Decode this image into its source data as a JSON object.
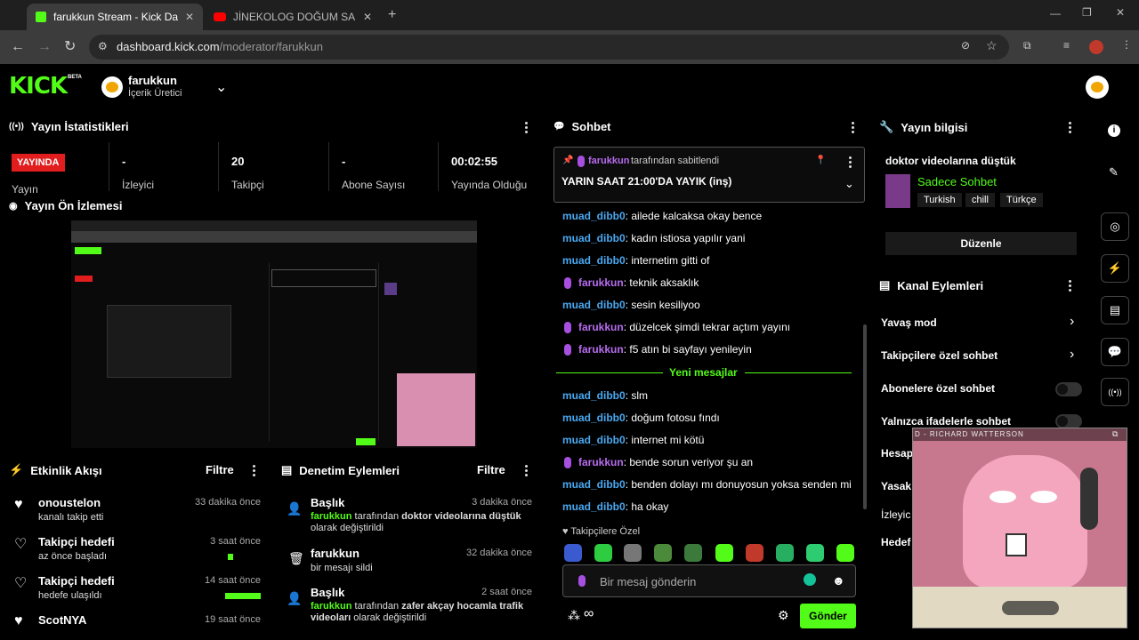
{
  "browser": {
    "tabs": [
      {
        "label": "farukkun Stream - Kick Dashboard"
      },
      {
        "label": "JİNEKOLOG DOĞUM SAHNELERİ"
      }
    ],
    "url_host": "dashboard.kick.com",
    "url_path": "/moderator/farukkun"
  },
  "header": {
    "logo_text": "KICK",
    "logo_badge": "BETA",
    "channel_name": "farukkun",
    "channel_role": "İçerik Üretici"
  },
  "stats": {
    "title": "Yayın İstatistikleri",
    "live_badge": "YAYINDA",
    "live_label": "Yayın",
    "viewers_value": "-",
    "viewers_label": "İzleyici",
    "followers_value": "20",
    "followers_label": "Takipçi",
    "subs_value": "-",
    "subs_label": "Abone Sayısı",
    "duration_value": "00:02:55",
    "duration_label": "Yayında Olduğu"
  },
  "preview": {
    "title": "Yayın Ön İzlemesi"
  },
  "activity": {
    "title": "Etkinlik Akışı",
    "filter": "Filtre",
    "items": [
      {
        "title": "onoustelon",
        "sub": "kanalı takip etti",
        "time": "33 dakika önce"
      },
      {
        "title": "Takipçi hedefi",
        "sub": "az önce başladı",
        "time": "3 saat önce"
      },
      {
        "title": "Takipçi hedefi",
        "sub": "hedefe ulaşıldı",
        "time": "14 saat önce"
      },
      {
        "title": "ScotNYA",
        "sub": "",
        "time": "19 saat önce"
      }
    ]
  },
  "moderation": {
    "title": "Denetim Eylemleri",
    "filter": "Filtre",
    "items": [
      {
        "title": "Başlık",
        "time": "3 dakika önce",
        "user": "farukkun",
        "mid": " tarafından ",
        "bold": "doktor videolarına düştük",
        "end": " olarak değiştirildi"
      },
      {
        "title": "farukkun",
        "time": "32 dakika önce",
        "line": "bir mesajı sildi"
      },
      {
        "title": "Başlık",
        "time": "2 saat önce",
        "user": "farukkun",
        "mid": " tarafından ",
        "bold": "zafer akçay hocamla trafik videoları",
        "end": " olarak değiştirildi"
      }
    ]
  },
  "chat": {
    "title": "Sohbet",
    "pinned_user": "farukkun",
    "pinned_by": "tarafından sabitlendi",
    "pinned_message": "YARIN SAAT 21:00'DA YAYIK (inş)",
    "messages_before": [
      {
        "user": "muad_dibb0",
        "text": ": ailede kalcaksa okay bence",
        "host": false
      },
      {
        "user": "muad_dibb0",
        "text": ": kadın istiosa yapılır yani",
        "host": false
      },
      {
        "user": "muad_dibb0",
        "text": ": internetim gitti of",
        "host": false
      },
      {
        "user": "farukkun",
        "text": ": teknik aksaklık",
        "host": true
      },
      {
        "user": "muad_dibb0",
        "text": ": sesin kesiliyoo",
        "host": false
      },
      {
        "user": "farukkun",
        "text": ": düzelcek şimdi tekrar açtım yayını",
        "host": true
      },
      {
        "user": "farukkun",
        "text": ": f5 atın bi sayfayı yenileyin",
        "host": true
      }
    ],
    "new_messages": "Yeni mesajlar",
    "messages_after": [
      {
        "user": "muad_dibb0",
        "text": ": slm",
        "host": false
      },
      {
        "user": "muad_dibb0",
        "text": ": doğum fotosu fındı",
        "host": false
      },
      {
        "user": "muad_dibb0",
        "text": ": internet mi kötü",
        "host": false
      },
      {
        "user": "farukkun",
        "text": ": bende sorun veriyor şu an",
        "host": true
      },
      {
        "user": "muad_dibb0",
        "text": ": benden dolayı mı donuyosun yoksa senden mi",
        "host": false
      },
      {
        "user": "muad_dibb0",
        "text": ": ha okay",
        "host": false
      }
    ],
    "followers_only": "Takipçilere Özel",
    "input_placeholder": "Bir mesaj gönderin",
    "send": "Gönder"
  },
  "stream_info": {
    "title": "Yayın bilgisi",
    "stream_title": "doktor videolarına düştük",
    "category": "Sadece Sohbet",
    "tags": [
      "Turkish",
      "chill",
      "Türkçe"
    ],
    "edit": "Düzenle"
  },
  "channel_actions": {
    "title": "Kanal Eylemleri",
    "slow_mode": "Yavaş mod",
    "followers_chat": "Takipçilere özel sohbet",
    "subs_chat": "Abonelere özel sohbet",
    "emote_chat": "Yalnızca ifadelerle sohbet",
    "cut1": "Hesap",
    "cut2": "Yasak",
    "cut3": "İzleyic",
    "cut4": "Hedef"
  },
  "pip": {
    "caption": "D - RICHARD WATTERSON"
  },
  "colors": {
    "kick_green": "#53fc18",
    "live_red": "#e11d1d",
    "host_purple": "#b86cf0",
    "user_blue": "#4aa8f0"
  }
}
